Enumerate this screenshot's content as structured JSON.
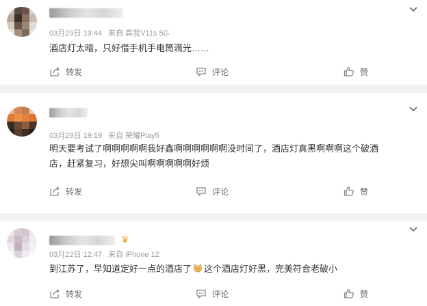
{
  "comments": [
    {
      "date": "03月29日 19:44",
      "source": "来自 真我V11s 5G",
      "text": "酒店灯太暗，只好借手机手电筒滴光……",
      "actions": {
        "share": "转发",
        "comment": "评论",
        "like": "赞"
      }
    },
    {
      "date": "03月29日 19:19",
      "source": "来自 荣耀Play5",
      "text_line1": "明天要考试了啊啊啊啊啊我好鑫啊啊啊啊啊啊没时间了，酒店灯真黑啊啊啊这个破酒",
      "text_line2": "店，赶紧复习，好想尖叫啊啊啊啊啊好烦",
      "actions": {
        "share": "转发",
        "comment": "评论",
        "like": "赞"
      }
    },
    {
      "date": "03月22日 12:47",
      "source": "来自 iPhone 12",
      "text_part1": "到江苏了，早知道定好一点的酒店了",
      "text_part2": "这个酒店灯好黑，完美符合老破小",
      "actions": {
        "share": "转发",
        "comment": "评论",
        "like": "赞"
      }
    }
  ],
  "icons": {
    "more": "chevron-down-icon",
    "share": "share-icon",
    "comment": "comment-icon",
    "like": "thumbs-up-icon",
    "vip": "crown-icon",
    "emoji": "cat-emoji-icon"
  },
  "colors": {
    "meta": "#999999",
    "text": "#333333",
    "separator": "#f2f2f5",
    "crown": "#f0a020"
  }
}
